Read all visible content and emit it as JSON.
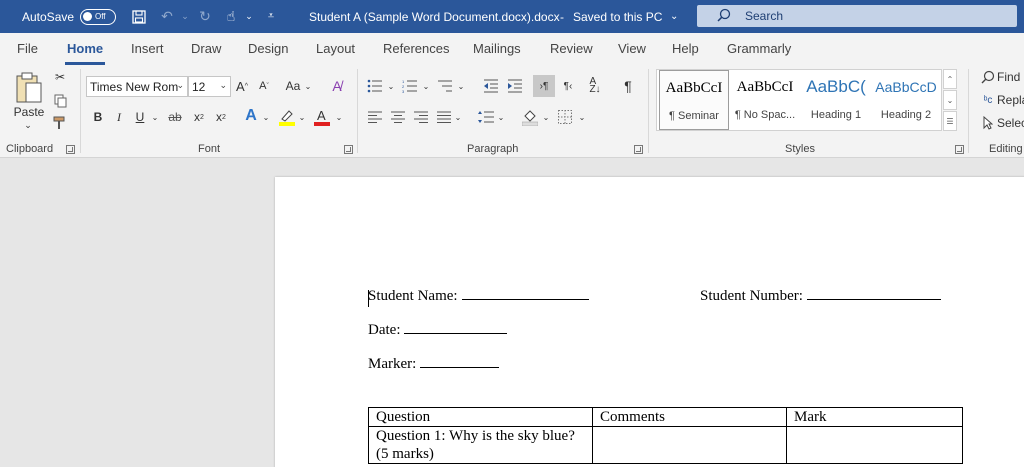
{
  "titlebar": {
    "autosave_label": "AutoSave",
    "autosave_state": "Off",
    "document_title": "Student A (Sample Word Document.docx).docx",
    "save_status": "Saved to this PC",
    "save_status_chevron": "⌄",
    "search_placeholder": "Search",
    "colors": {
      "bar": "#2b579a",
      "search": "#c4d2e7"
    }
  },
  "tabs": [
    "File",
    "Home",
    "Insert",
    "Draw",
    "Design",
    "Layout",
    "References",
    "Mailings",
    "Review",
    "View",
    "Help",
    "Grammarly"
  ],
  "active_tab": "Home",
  "ribbon": {
    "clipboard": {
      "paste_label": "Paste",
      "group_label": "Clipboard"
    },
    "font": {
      "font_name": "Times New Rom",
      "font_size": "12",
      "case_label": "Aa",
      "group_label": "Font"
    },
    "paragraph": {
      "group_label": "Paragraph"
    },
    "styles": {
      "group_label": "Styles",
      "items": [
        {
          "sample": "AaBbCcI",
          "name": "¶ Seminar"
        },
        {
          "sample": "AaBbCcI",
          "name": "¶ No Spac..."
        },
        {
          "sample": "AaBbC(",
          "name": "Heading 1"
        },
        {
          "sample": "AaBbCcD",
          "name": "Heading 2"
        }
      ]
    },
    "editing": {
      "group_label": "Editing",
      "find_label": "Find",
      "replace_label": "Repla",
      "select_label": "Selec"
    }
  },
  "document": {
    "student_name_label": "Student Name:",
    "student_number_label": "Student Number:",
    "date_label": "Date:",
    "marker_label": "Marker:",
    "table": {
      "headers": [
        "Question",
        "Comments",
        "Mark"
      ],
      "rows": [
        {
          "question_line1": "Question 1: Why is the sky blue?",
          "question_line2": "(5 marks)",
          "comments": "",
          "mark": ""
        }
      ]
    }
  }
}
